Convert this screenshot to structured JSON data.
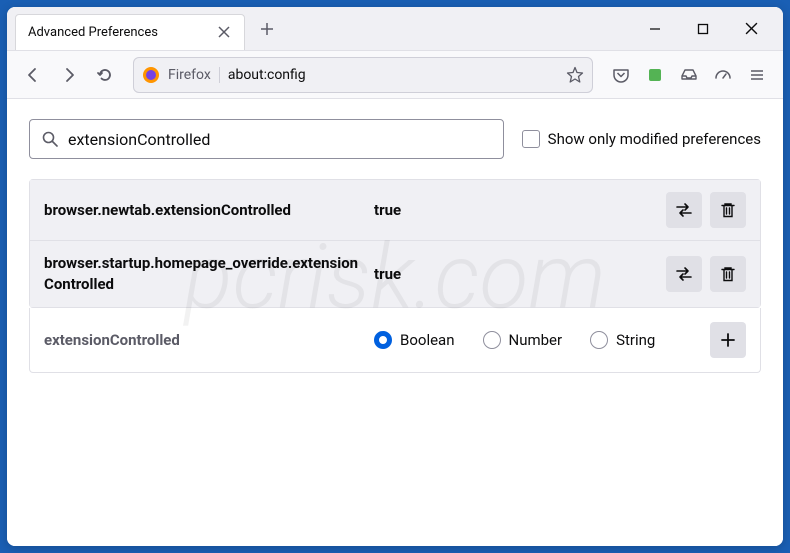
{
  "window": {
    "tab_title": "Advanced Preferences"
  },
  "toolbar": {
    "identity": "Firefox",
    "url": "about:config"
  },
  "search": {
    "value": "extensionControlled",
    "modified_label": "Show only modified preferences"
  },
  "results": [
    {
      "name": "browser.newtab.extensionControlled",
      "value": "true"
    },
    {
      "name": "browser.startup.homepage_override.extensionControlled",
      "value": "true"
    }
  ],
  "add": {
    "name": "extensionControlled",
    "types": {
      "boolean": "Boolean",
      "number": "Number",
      "string": "String"
    },
    "selected": "boolean"
  },
  "watermark": "pcrisk.com"
}
